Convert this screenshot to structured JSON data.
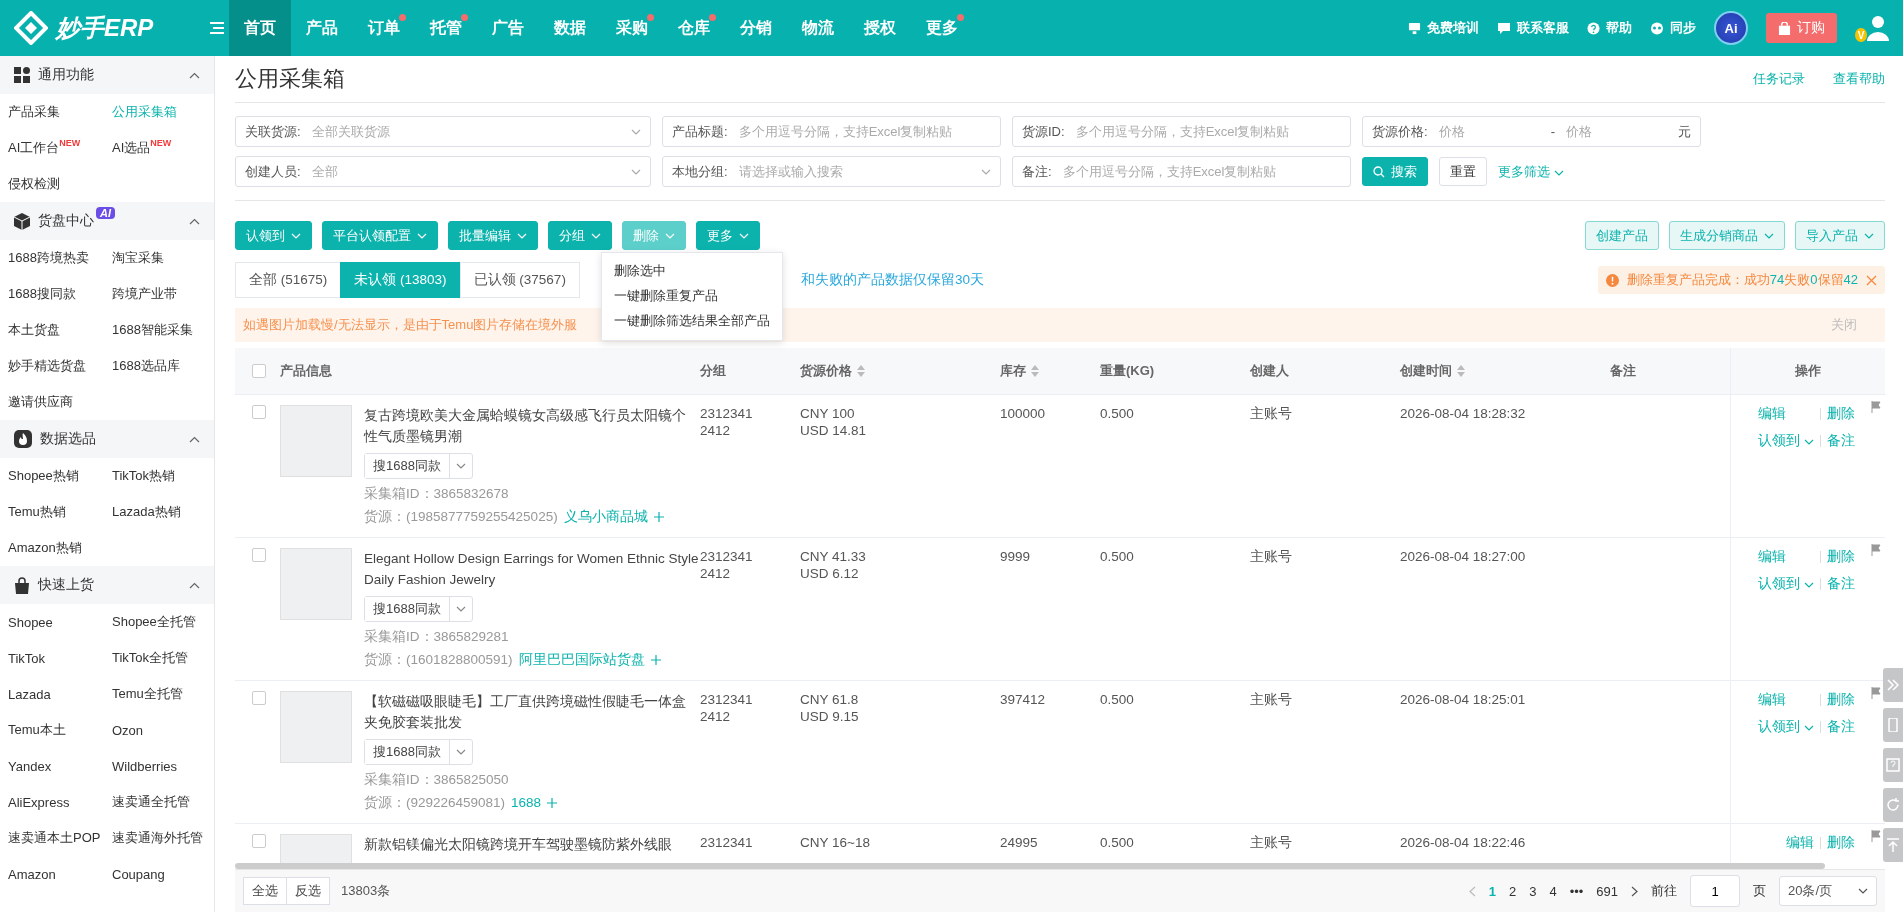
{
  "topbar": {
    "logo": "妙手ERP",
    "nav": [
      {
        "label": "首页",
        "selected": true,
        "dot": false
      },
      {
        "label": "产品",
        "selected": false,
        "dot": false
      },
      {
        "label": "订单",
        "selected": false,
        "dot": true
      },
      {
        "label": "托管",
        "selected": false,
        "dot": true
      },
      {
        "label": "广告",
        "selected": false,
        "dot": false
      },
      {
        "label": "数据",
        "selected": false,
        "dot": false
      },
      {
        "label": "采购",
        "selected": false,
        "dot": true
      },
      {
        "label": "仓库",
        "selected": false,
        "dot": true
      },
      {
        "label": "分销",
        "selected": false,
        "dot": false
      },
      {
        "label": "物流",
        "selected": false,
        "dot": false
      },
      {
        "label": "授权",
        "selected": false,
        "dot": false
      },
      {
        "label": "更多",
        "selected": false,
        "dot": true
      }
    ],
    "tools": [
      {
        "kind": "training",
        "label": "免费培训"
      },
      {
        "kind": "service",
        "label": "联系客服"
      },
      {
        "kind": "help",
        "label": "帮助"
      },
      {
        "kind": "sync",
        "label": "同步"
      }
    ],
    "ai": "Ai",
    "order": "订购",
    "vip": "V"
  },
  "sidebar": [
    {
      "kind": "grid",
      "title": "通用功能",
      "expanded": true,
      "items": [
        {
          "label": "产品采集",
          "selected": false
        },
        {
          "label": "公用采集箱",
          "selected": true
        },
        {
          "label": "AI工作台",
          "badge": "NEW",
          "selected": false
        },
        {
          "label": "AI选品",
          "badge": "NEW",
          "selected": false
        },
        {
          "label": "侵权检测",
          "selected": false
        }
      ]
    },
    {
      "kind": "cube",
      "title": "货盘中心",
      "badge": "AI",
      "expanded": true,
      "items": [
        {
          "label": "1688跨境热卖",
          "selected": false
        },
        {
          "label": "淘宝采集",
          "selected": false
        },
        {
          "label": "1688搜同款",
          "selected": false
        },
        {
          "label": "跨境产业带",
          "selected": false
        },
        {
          "label": "本土货盘",
          "selected": false
        },
        {
          "label": "1688智能采集",
          "selected": false
        },
        {
          "label": "妙手精选货盘",
          "selected": false
        },
        {
          "label": "1688选品库",
          "selected": false
        },
        {
          "label": "邀请供应商",
          "selected": false
        }
      ]
    },
    {
      "kind": "fire",
      "title": "数据选品",
      "expanded": true,
      "items": [
        {
          "label": "Shopee热销",
          "selected": false
        },
        {
          "label": "TikTok热销",
          "selected": false
        },
        {
          "label": "Temu热销",
          "selected": false
        },
        {
          "label": "Lazada热销",
          "selected": false
        },
        {
          "label": "Amazon热销",
          "selected": false
        }
      ]
    },
    {
      "kind": "bag",
      "title": "快速上货",
      "expanded": true,
      "items": [
        {
          "label": "Shopee",
          "selected": false
        },
        {
          "label": "Shopee全托管",
          "selected": false
        },
        {
          "label": "TikTok",
          "selected": false
        },
        {
          "label": "TikTok全托管",
          "selected": false
        },
        {
          "label": "Lazada",
          "selected": false
        },
        {
          "label": "Temu全托管",
          "selected": false
        },
        {
          "label": "Temu本土",
          "selected": false
        },
        {
          "label": "Ozon",
          "selected": false
        },
        {
          "label": "Yandex",
          "selected": false
        },
        {
          "label": "Wildberries",
          "selected": false
        },
        {
          "label": "AliExpress",
          "selected": false
        },
        {
          "label": "速卖通全托管",
          "selected": false
        },
        {
          "label": "速卖通本土POP",
          "selected": false
        },
        {
          "label": "速卖通海外托管",
          "selected": false
        },
        {
          "label": "Amazon",
          "selected": false
        },
        {
          "label": "Coupang",
          "selected": false
        }
      ]
    }
  ],
  "page": {
    "title": "公用采集箱",
    "links": [
      "任务记录",
      "查看帮助"
    ]
  },
  "filters": [
    {
      "kind": "select",
      "label": "关联货源:",
      "placeholder": "全部关联货源"
    },
    {
      "kind": "input",
      "label": "产品标题:",
      "placeholder": "多个用逗号分隔，支持Excel复制粘贴"
    },
    {
      "kind": "input",
      "label": "货源ID:",
      "placeholder": "多个用逗号分隔，支持Excel复制粘贴"
    },
    {
      "kind": "range",
      "label": "货源价格:",
      "placeholder": "价格",
      "placeholder_to": "价格",
      "separator": "-",
      "unit": "元"
    },
    {
      "kind": "select",
      "label": "创建人员:",
      "placeholder": "全部"
    },
    {
      "kind": "select",
      "label": "本地分组:",
      "placeholder": "请选择或输入搜索"
    },
    {
      "kind": "input",
      "label": "备注:",
      "placeholder": "多个用逗号分隔，支持Excel复制粘贴"
    }
  ],
  "filter_actions": {
    "search": "搜索",
    "reset": "重置",
    "more": "更多筛选"
  },
  "toolbar": {
    "left": [
      {
        "label": "认领到",
        "open": false
      },
      {
        "label": "平台认领配置",
        "open": false
      },
      {
        "label": "批量编辑",
        "open": false
      },
      {
        "label": "分组",
        "open": false
      },
      {
        "label": "删除",
        "open": true
      },
      {
        "label": "更多",
        "open": false
      }
    ],
    "right": [
      {
        "label": "创建产品",
        "caret": false
      },
      {
        "label": "生成分销商品",
        "caret": true
      },
      {
        "label": "导入产品",
        "caret": true
      }
    ]
  },
  "delete_menu": [
    "删除选中",
    "一键删除重复产品",
    "一键删除筛选结果全部产品"
  ],
  "tabs": [
    {
      "label": "全部 (51675)",
      "selected": false
    },
    {
      "label": "未认领 (13803)",
      "selected": true
    },
    {
      "label": "已认领 (37567)",
      "selected": false
    }
  ],
  "tabs_note": "和失败的产品数据仅保留30天",
  "alert": [
    {
      "text": "删除重复产品完成：成功",
      "highlight": false
    },
    {
      "text": "74",
      "highlight": true
    },
    {
      "text": "失败",
      "highlight": false
    },
    {
      "text": "0",
      "highlight": true
    },
    {
      "text": "保留",
      "highlight": false
    },
    {
      "text": "42",
      "highlight": true
    }
  ],
  "banner": {
    "text": "如遇图片加载慢/无法显示，是由于Temu图片存储在境外服",
    "close": "关闭"
  },
  "table": {
    "all_checked": false,
    "columns": [
      {
        "label": "产品信息",
        "sortable": false
      },
      {
        "label": "分组",
        "sortable": false
      },
      {
        "label": "货源价格",
        "sortable": true
      },
      {
        "label": "库存",
        "sortable": true
      },
      {
        "label": "重量(KG)",
        "sortable": false
      },
      {
        "label": "创建人",
        "sortable": false
      },
      {
        "label": "创建时间",
        "sortable": true
      },
      {
        "label": "备注",
        "sortable": false
      },
      {
        "label": "操作",
        "sortable": false
      }
    ],
    "rows": [
      {
        "checked": false,
        "title": "复古跨境欧美大金属蛤蟆镜女高级感飞行员太阳镜个性气质墨镜男潮",
        "search": "搜1688同款",
        "box_id": "采集箱ID：3865832678",
        "source": "货源：(1985877759255425025)",
        "source_link": "义乌小商品城",
        "group": [
          "2312341",
          "2412"
        ],
        "price": [
          "CNY 100",
          "USD 14.81"
        ],
        "stock": "100000",
        "weight": "0.500",
        "creator": "主账号",
        "time": "2026-08-04 18:28:32",
        "ops": [
          "编辑",
          "删除",
          "认领到",
          "备注"
        ]
      },
      {
        "checked": false,
        "title": "Elegant Hollow Design Earrings for Women Ethnic Style Daily Fashion Jewelry",
        "search": "搜1688同款",
        "box_id": "采集箱ID：3865829281",
        "source": "货源：(1601828800591)",
        "source_link": "阿里巴巴国际站货盘",
        "group": [
          "2312341",
          "2412"
        ],
        "price": [
          "CNY 41.33",
          "USD 6.12"
        ],
        "stock": "9999",
        "weight": "0.500",
        "creator": "主账号",
        "time": "2026-08-04 18:27:00",
        "ops": [
          "编辑",
          "删除",
          "认领到",
          "备注"
        ]
      },
      {
        "checked": false,
        "title": "【软磁磁吸眼睫毛】工厂直供跨境磁性假睫毛一体盒夹免胶套装批发",
        "search": "搜1688同款",
        "box_id": "采集箱ID：3865825050",
        "source": "货源：(929226459081)",
        "source_link": "1688",
        "group": [
          "2312341",
          "2412"
        ],
        "price": [
          "CNY 61.8",
          "USD 9.15"
        ],
        "stock": "397412",
        "weight": "0.500",
        "creator": "主账号",
        "time": "2026-08-04 18:25:01",
        "ops": [
          "编辑",
          "删除",
          "认领到",
          "备注"
        ]
      },
      {
        "checked": false,
        "title": "新款铝镁偏光太阳镜跨境开车驾驶墨镜防紫外线眼",
        "group": [
          "2312341"
        ],
        "price": [
          "CNY 16~18"
        ],
        "stock": "24995",
        "weight": "0.500",
        "creator": "主账号",
        "time": "2026-08-04 18:22:46",
        "ops": [
          "编辑",
          "删除"
        ]
      }
    ]
  },
  "footer": {
    "select_all": "全选",
    "invert": "反选",
    "count": "13803条",
    "pages": [
      {
        "label": "1",
        "selected": true
      },
      {
        "label": "2",
        "selected": false
      },
      {
        "label": "3",
        "selected": false
      },
      {
        "label": "4",
        "selected": false
      },
      {
        "label": "•••",
        "selected": false
      },
      {
        "label": "691",
        "selected": false
      }
    ],
    "goto": "前往",
    "page_value": "1",
    "page_unit": "页",
    "page_size": "20条/页"
  }
}
